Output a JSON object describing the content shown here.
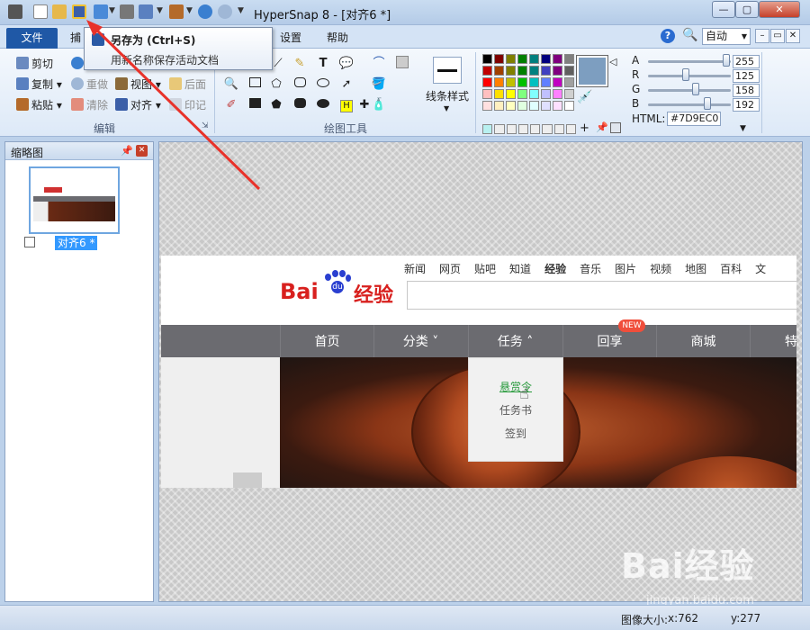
{
  "window": {
    "title": "HyperSnap 8 - [对齐6 *]"
  },
  "ribbon_tabs": {
    "file": "文件",
    "capture": "捕",
    "settings": "设置",
    "help": "帮助"
  },
  "zoom": {
    "value": "自动"
  },
  "tooltip": {
    "title": "另存为 (Ctrl+S)",
    "description": "用新名称保存活动文档"
  },
  "edit_group": {
    "cut": "剪切",
    "copy": "复制",
    "paste": "粘贴",
    "redo": "重做",
    "clear": "清除",
    "view": "视图",
    "align": "对齐",
    "back": "后面",
    "stamp": "印记",
    "label": "编辑"
  },
  "draw_group": {
    "label": "绘图工具",
    "line_style": "线条样式"
  },
  "color_panel": {
    "r_label": "R",
    "g_label": "G",
    "b_label": "B",
    "a_label": "A",
    "a": "255",
    "r": "125",
    "g": "158",
    "b": "192",
    "html_label": "HTML:",
    "html_value": "#7D9EC0",
    "current_color": "#7D9EC0"
  },
  "thumbnail_panel": {
    "title": "缩略图",
    "item_label": "对齐6 *"
  },
  "baidu_page": {
    "nav": [
      "新闻",
      "网页",
      "贴吧",
      "知道",
      "经验",
      "音乐",
      "图片",
      "视频",
      "地图",
      "百科",
      "文"
    ],
    "logo_text": "Bai",
    "logo_text2": "经验",
    "menu": [
      "首页",
      "分类 ˅",
      "任务 ˄",
      "回享",
      "商城",
      "特"
    ],
    "new_badge": "NEW",
    "dropdown": [
      "悬赏令",
      "任务书",
      "签到"
    ]
  },
  "watermark": {
    "logo": "Bai经验",
    "url": "jingyan.baidu.com"
  },
  "status": {
    "size_label": "图像大小:",
    "width": "x:762",
    "height": "y:277"
  }
}
